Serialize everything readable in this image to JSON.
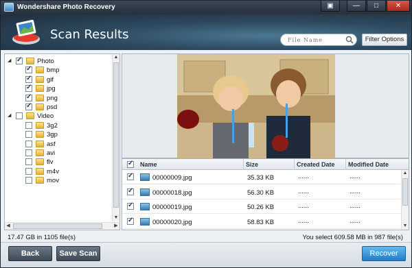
{
  "window": {
    "title": "Wondershare Photo Recovery",
    "controls": [
      "▣",
      "—",
      "□",
      "✕"
    ]
  },
  "header": {
    "title": "Scan Results",
    "search_placeholder": "File Name",
    "filter_label": "Filter Options"
  },
  "tree": {
    "items": [
      {
        "label": "Photo",
        "level": 0,
        "checked": true,
        "expander": "◢"
      },
      {
        "label": "bmp",
        "level": 1,
        "checked": true
      },
      {
        "label": "gif",
        "level": 1,
        "checked": true
      },
      {
        "label": "jpg",
        "level": 1,
        "checked": true
      },
      {
        "label": "png",
        "level": 1,
        "checked": true
      },
      {
        "label": "psd",
        "level": 1,
        "checked": true
      },
      {
        "label": "Video",
        "level": 0,
        "checked": false,
        "expander": "◢"
      },
      {
        "label": "3g2",
        "level": 1,
        "checked": false
      },
      {
        "label": "3gp",
        "level": 1,
        "checked": false
      },
      {
        "label": "asf",
        "level": 1,
        "checked": false
      },
      {
        "label": "avi",
        "level": 1,
        "checked": false
      },
      {
        "label": "flv",
        "level": 1,
        "checked": false
      },
      {
        "label": "m4v",
        "level": 1,
        "checked": false
      },
      {
        "label": "mov",
        "level": 1,
        "checked": false
      }
    ]
  },
  "table": {
    "columns": [
      "Name",
      "Size",
      "Created Date",
      "Modified Date"
    ],
    "rows": [
      {
        "name": "00000009.jpg",
        "size": "35.33 KB",
        "created": "......",
        "modified": "......"
      },
      {
        "name": "00000018.jpg",
        "size": "56.30 KB",
        "created": "......",
        "modified": "......"
      },
      {
        "name": "00000019.jpg",
        "size": "50.26 KB",
        "created": "......",
        "modified": "......"
      },
      {
        "name": "00000020.jpg",
        "size": "58.83 KB",
        "created": "......",
        "modified": "......"
      }
    ]
  },
  "status": {
    "left": "17.47 GB in 1105 file(s)",
    "right": "You select 609.58 MB in 987 file(s)"
  },
  "footer": {
    "back": "Back",
    "save_scan": "Save Scan",
    "recover": "Recover"
  },
  "colors": {
    "accent": "#1f7cc7",
    "header_bg": "#2e4a60"
  }
}
